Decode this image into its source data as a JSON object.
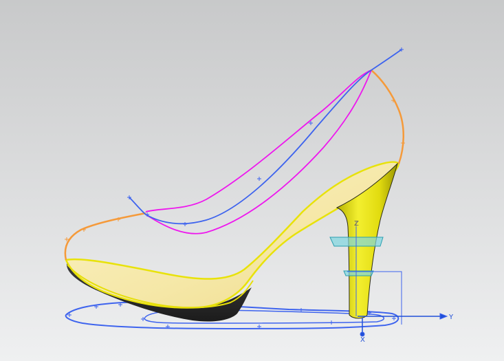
{
  "viewport": {
    "background_top": "#c9cacb",
    "background_bottom": "#eeeff0"
  },
  "colors": {
    "orange_curve": "#f59a3a",
    "magenta_curve": "#ee16ee",
    "blue_curve": "#3d63ee",
    "insole_fill": "#f6eab0",
    "insole_edge": "#e8e20a",
    "outsole": "#2b2b2b",
    "heel_yellow": "#e8e414",
    "plane_cyan": "#4fc3d1",
    "axis_blue": "#2050d8"
  },
  "axes": {
    "z_label": "Z",
    "y_label": "Y",
    "x_label": "X"
  },
  "icons": {
    "datum_csys": "datum-csys-icon",
    "point_marker": "plus-marker-icon"
  }
}
